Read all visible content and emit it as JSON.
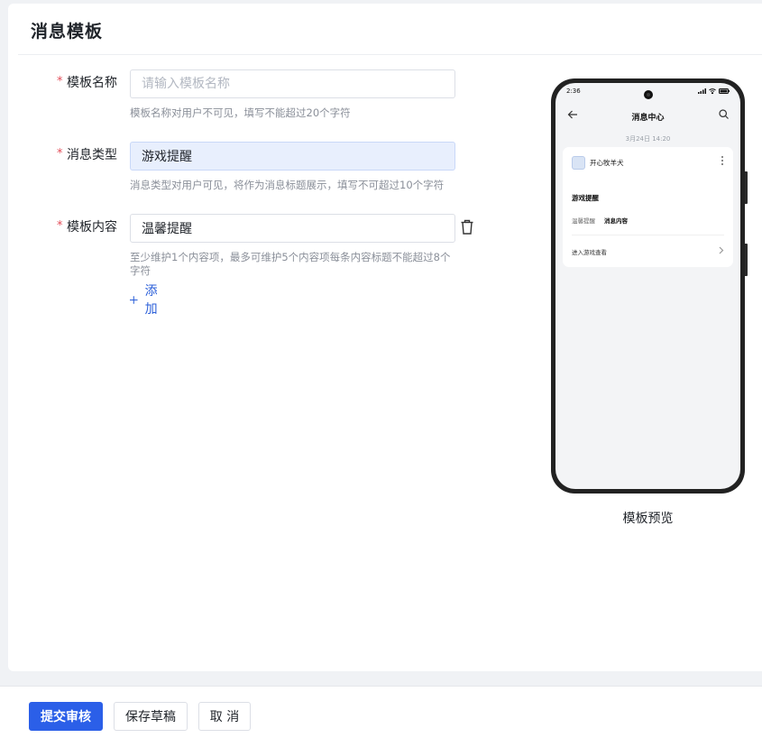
{
  "page": {
    "title": "消息模板"
  },
  "form": {
    "required_mark": "*",
    "template_name": {
      "label": "模板名称",
      "value": "",
      "placeholder": "请输入模板名称",
      "hint": "模板名称对用户不可见，填写不能超过20个字符"
    },
    "message_type": {
      "label": "消息类型",
      "value": "游戏提醒",
      "hint": "消息类型对用户可见，将作为消息标题展示，填写不可超过10个字符"
    },
    "template_content": {
      "label": "模板内容",
      "value": "温馨提醒",
      "hint": "至少维护1个内容项，最多可维护5个内容项每条内容标题不能超过8个字符",
      "add_label": "添加"
    }
  },
  "preview": {
    "caption": "模板预览",
    "status_time": "2:36",
    "nav_title": "消息中心",
    "date": "3月24日 14:20",
    "app_name": "开心牧羊犬",
    "message_title": "游戏提醒",
    "content_key": "温馨提醒",
    "content_value": "消息内容",
    "enter_text": "进入游戏查看"
  },
  "footer": {
    "submit": "提交审核",
    "save_draft": "保存草稿",
    "cancel": "取 消"
  },
  "colors": {
    "primary": "#2b5fe8",
    "link": "#2b5fd9",
    "required": "#e34d59",
    "selected_bg": "#e8effd"
  }
}
